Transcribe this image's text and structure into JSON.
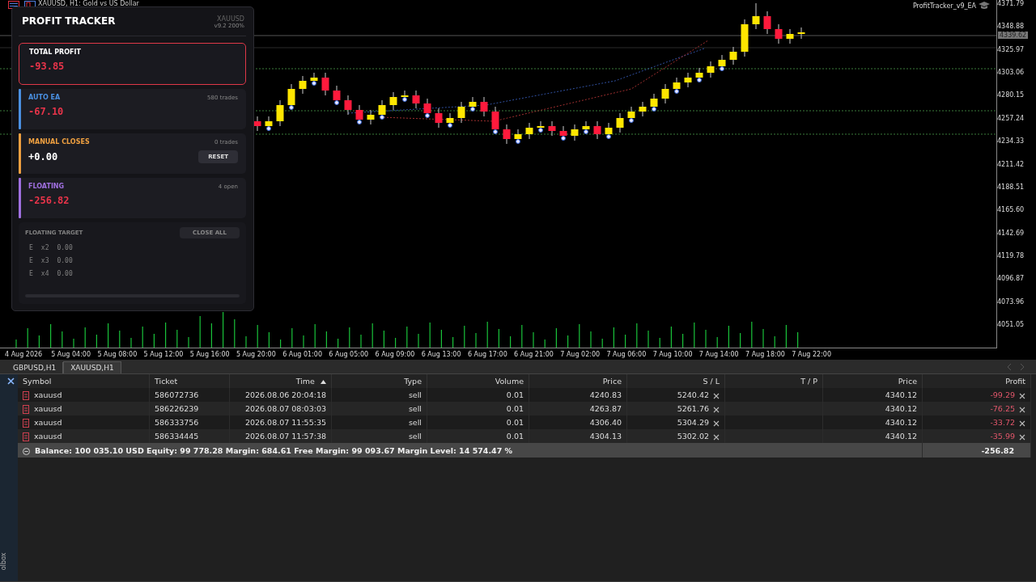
{
  "chart": {
    "title": "XAUUSD, H1:  Gold vs US Dollar",
    "ea_label": "ProfitTracker_v9_EA",
    "price_ticks": [
      "4371.79",
      "4348.88",
      "4325.97",
      "4303.06",
      "4280.15",
      "4257.24",
      "4234.33",
      "4211.42",
      "4188.51",
      "4165.60",
      "4142.69",
      "4119.78",
      "4096.87",
      "4073.96",
      "4051.05"
    ],
    "current_price": "4339.62",
    "time_labels": [
      "4 Aug 2026",
      "5 Aug 04:00",
      "5 Aug 08:00",
      "5 Aug 12:00",
      "5 Aug 16:00",
      "5 Aug 20:00",
      "6 Aug 01:00",
      "6 Aug 05:00",
      "6 Aug 09:00",
      "6 Aug 13:00",
      "6 Aug 17:00",
      "6 Aug 21:00",
      "7 Aug 02:00",
      "7 Aug 06:00",
      "7 Aug 10:00",
      "7 Aug 14:00",
      "7 Aug 18:00",
      "7 Aug 22:00"
    ]
  },
  "panel": {
    "title": "PROFIT TRACKER",
    "symbol": "XAUUSD",
    "version": "v9.2 200%",
    "cards": [
      {
        "kind": "total",
        "label": "TOTAL PROFIT",
        "value": "-93.85",
        "loss": true
      },
      {
        "kind": "stream",
        "label": "AUTO EA",
        "count": "580 trades",
        "value": "-67.10",
        "loss": true,
        "color": "#4a90e2"
      },
      {
        "kind": "stream",
        "label": "MANUAL CLOSES",
        "count": "0 trades",
        "value": "+0.00",
        "loss": false,
        "color": "#f0a040",
        "button": "RESET"
      },
      {
        "kind": "stream",
        "label": "FLOATING",
        "count": "4 open",
        "value": "-256.82",
        "loss": true,
        "color": "#a070e0"
      }
    ],
    "target": {
      "label": "FLOATING TARGET",
      "button": "CLOSE ALL",
      "disabled": true,
      "level": 0,
      "rows": [
        {
          "marker": "E",
          "multiplier": "x2",
          "value": "0.00"
        },
        {
          "marker": "E",
          "multiplier": "x3",
          "value": "0.00"
        },
        {
          "marker": "E",
          "multiplier": "x4",
          "value": "0.00"
        }
      ]
    }
  },
  "symbol_tabs": [
    {
      "label": "GBPUSD,H1",
      "selected": false
    },
    {
      "label": "XAUUSD,H1",
      "selected": true
    }
  ],
  "trade_table": {
    "columns": [
      {
        "label": "Symbol",
        "sorted": false
      },
      {
        "label": "Ticket",
        "sorted": false
      },
      {
        "label": "Time",
        "sorted": true
      },
      {
        "label": "Type",
        "sorted": false
      },
      {
        "label": "Volume",
        "sorted": false
      },
      {
        "label": "Price",
        "sorted": false
      },
      {
        "label": "S / L",
        "sorted": false
      },
      {
        "label": "T / P",
        "sorted": false
      },
      {
        "label": "Price",
        "sorted": false
      },
      {
        "label": "Profit",
        "sorted": false
      }
    ],
    "rows": [
      {
        "symbol": "xauusd",
        "ticket": "586072736",
        "time": "2026.08.06 20:04:18",
        "type": "sell",
        "volume": "0.01",
        "price": "4240.83",
        "sl": "5240.42",
        "current_price": "4340.12",
        "profit": "-99.29"
      },
      {
        "symbol": "xauusd",
        "ticket": "586226239",
        "time": "2026.08.07 08:03:03",
        "type": "sell",
        "volume": "0.01",
        "price": "4263.87",
        "sl": "5261.76",
        "current_price": "4340.12",
        "profit": "-76.25"
      },
      {
        "symbol": "xauusd",
        "ticket": "586333756",
        "time": "2026.08.07 11:55:35",
        "type": "sell",
        "volume": "0.01",
        "price": "4306.40",
        "sl": "5304.29",
        "current_price": "4340.12",
        "profit": "-33.72"
      },
      {
        "symbol": "xauusd",
        "ticket": "586334445",
        "time": "2026.08.07 11:57:38",
        "type": "sell",
        "volume": "0.01",
        "price": "4304.13",
        "sl": "5302.02",
        "current_price": "4340.12",
        "profit": "-35.99"
      }
    ],
    "summary": "Balance: 100 035.10 USD  Equity: 99 778.28  Margin: 684.61  Free Margin: 99 093.67  Margin Level: 14 574.47 %",
    "total": "-256.82"
  },
  "toolbox_label": "olbox"
}
